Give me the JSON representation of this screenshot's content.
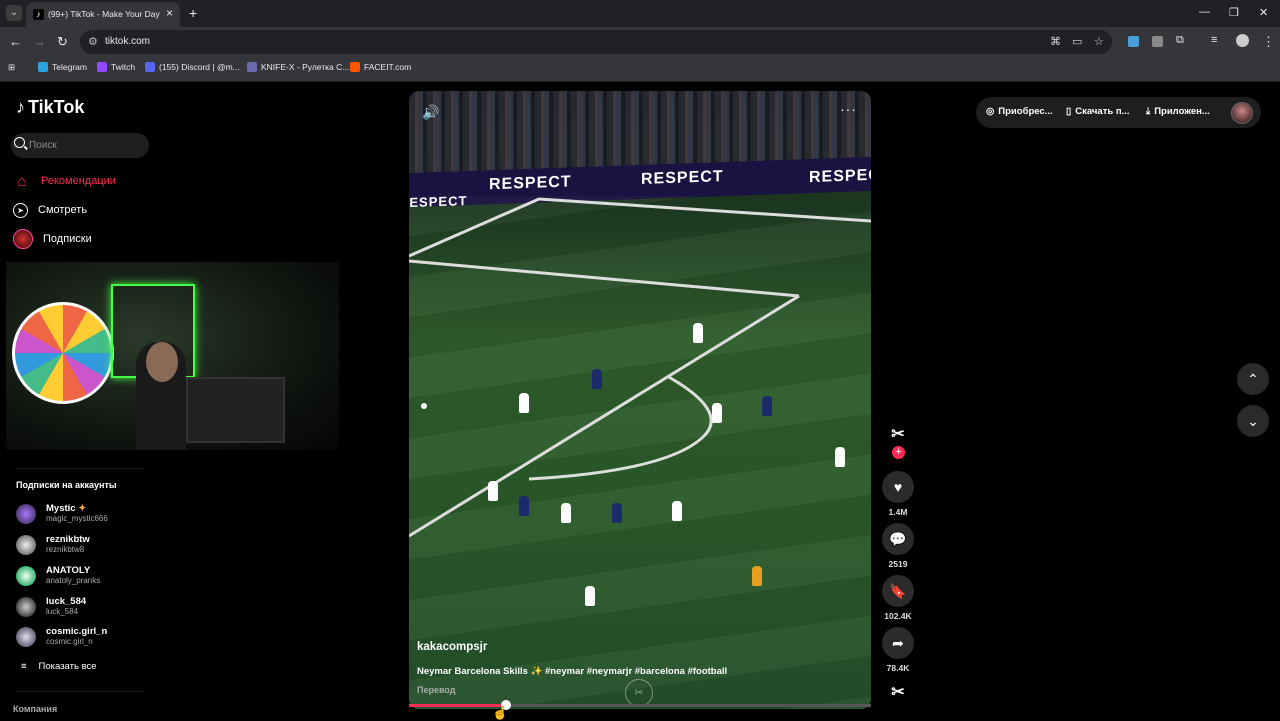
{
  "browser": {
    "tab_title": "(99+) TikTok - Make Your Day",
    "url": "tiktok.com",
    "bookmarks": [
      {
        "label": "Telegram",
        "color": "#2aa3e0"
      },
      {
        "label": "Twitch",
        "color": "#9146ff"
      },
      {
        "label": "(155) Discord | @m...",
        "color": "#5865f2"
      },
      {
        "label": "KNIFE-X - Рулетка С...",
        "color": "#6a6aaa"
      },
      {
        "label": "FACEIT.com",
        "color": "#ff5500"
      }
    ]
  },
  "app": {
    "logo": "TikTok",
    "search_placeholder": "Поиск",
    "nav": [
      {
        "label": "Рекомендации",
        "active": true
      },
      {
        "label": "Смотреть",
        "active": false
      },
      {
        "label": "Подписки",
        "active": false
      }
    ],
    "following_title": "Подписки на аккаунты",
    "following": [
      {
        "name": "Mystic",
        "handle": "magic_mystic666",
        "color": "#6b4ac8"
      },
      {
        "name": "reznikbtw",
        "handle": "reznikbtw8",
        "color": "#ddd"
      },
      {
        "name": "ANATOLY",
        "handle": "anatoly_pranks",
        "color": "#8fc"
      },
      {
        "name": "luck_584",
        "handle": "luck_584",
        "color": "#999"
      },
      {
        "name": "cosmic.girl_n",
        "handle": "cosmic.girl_n",
        "color": "#aac"
      }
    ],
    "show_all": "Показать все",
    "company": "Компания"
  },
  "video": {
    "ad_board": "RESPECT",
    "author": "kakacompsjr",
    "description": "Neymar Barcelona Skills ✨ #neymar #neymarjr #barcelona #football",
    "translate": "Перевод",
    "progress": 0.21
  },
  "actions": {
    "likes": "1.4M",
    "comments": "2519",
    "bookmarks": "102.4K",
    "shares": "78.4K"
  },
  "topright": {
    "buy": "Приобрес...",
    "download": "Скачать п...",
    "app": "Приложен..."
  },
  "colors": {
    "accent": "#fe2c55"
  }
}
